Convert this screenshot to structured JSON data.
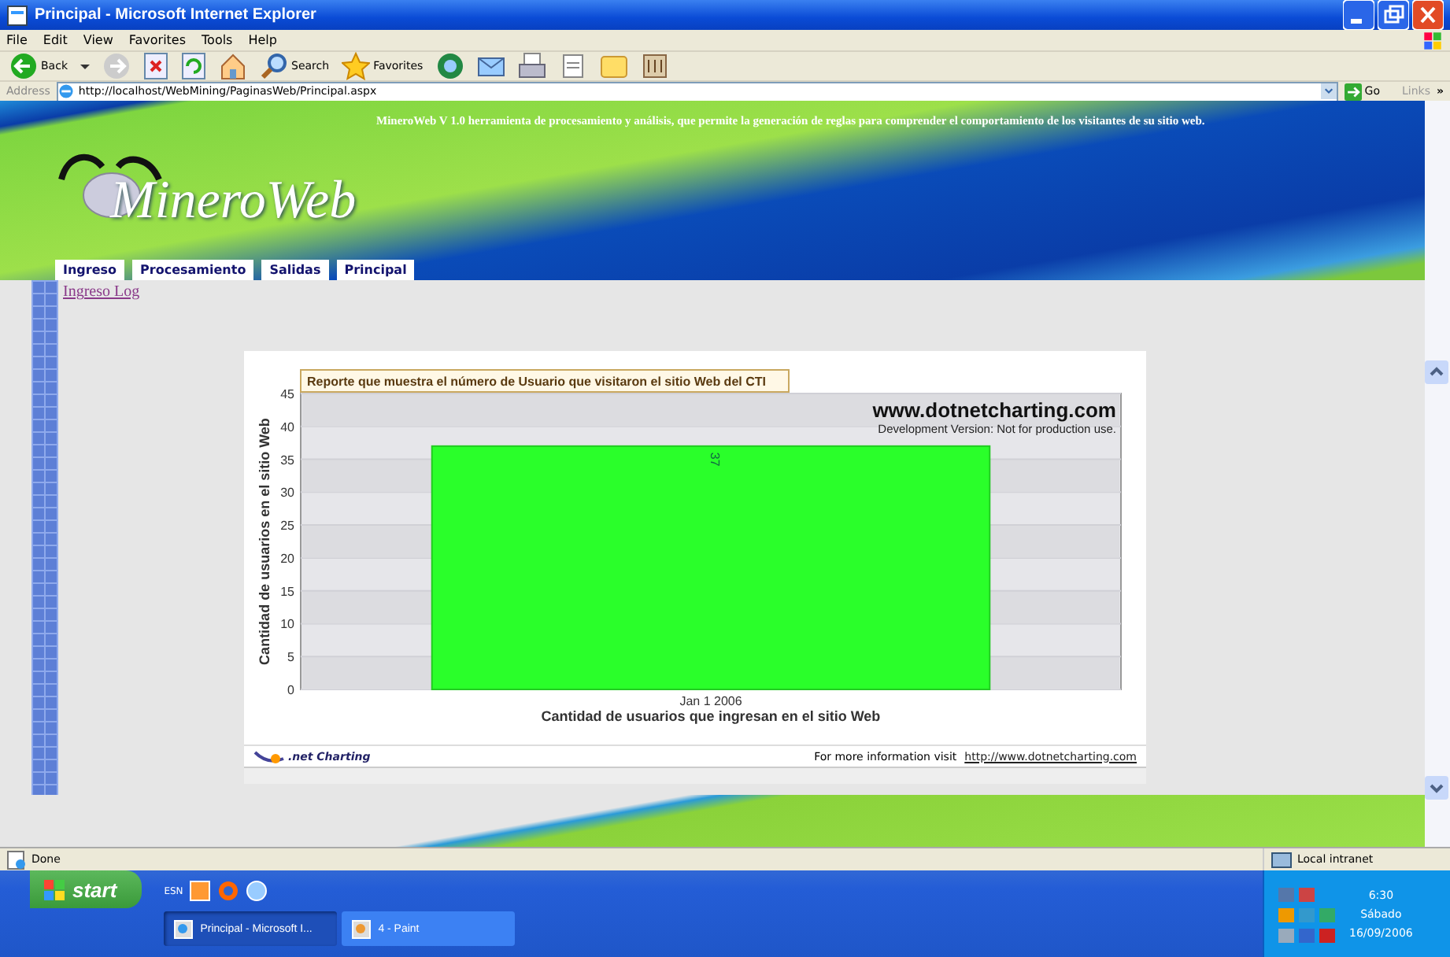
{
  "window": {
    "title": "Principal - Microsoft Internet Explorer"
  },
  "menu": [
    "File",
    "Edit",
    "View",
    "Favorites",
    "Tools",
    "Help"
  ],
  "toolbar": {
    "back": "Back",
    "search": "Search",
    "favorites": "Favorites"
  },
  "address": {
    "label": "Address",
    "value": "http://localhost/WebMining/PaginasWeb/Principal.aspx",
    "go": "Go",
    "links": "Links",
    "more": "»"
  },
  "site": {
    "tagline": "MineroWeb V 1.0 herramienta de procesamiento y análisis, que permite la generación de reglas para comprender el comportamiento de los visitantes de su sitio web.",
    "logo": "MineroWeb",
    "tabs": [
      "Ingreso",
      "Procesamiento",
      "Salidas",
      "Principal"
    ],
    "link": "Ingreso Log"
  },
  "chart": {
    "brand": "www.dotnetcharting.com",
    "notice": "Development Version: Not for production use.",
    "footer_logo": ".net Charting",
    "footer_text": "For more information visit",
    "footer_link": "http://www.dotnetcharting.com",
    "chart_data": {
      "type": "bar",
      "title": "Reporte que muestra el número de Usuario que visitaron el sitio Web del CTI",
      "xlabel": "Cantidad de usuarios que ingresan en el sitio Web",
      "ylabel": "Cantidad de usuarios en el sitio Web",
      "categories": [
        "Jan  1 2006"
      ],
      "series": [
        {
          "color": "#2aff2a",
          "values": [
            37
          ]
        }
      ],
      "ylim": [
        0,
        45
      ],
      "yticks": [
        0,
        5,
        10,
        15,
        20,
        25,
        30,
        35,
        40,
        45
      ],
      "data_labels": true,
      "grid": true
    }
  },
  "status_bar": {
    "text": "Done",
    "zone": "Local intranet"
  },
  "taskbar": {
    "start": "start",
    "lang": "ESN",
    "tasks": [
      {
        "label": "Principal - Microsoft I...",
        "selected": true
      },
      {
        "label": "4 - Paint",
        "selected": false
      }
    ],
    "clock": {
      "time": "6:30",
      "day": "Sábado",
      "date": "16/09/2006"
    }
  }
}
